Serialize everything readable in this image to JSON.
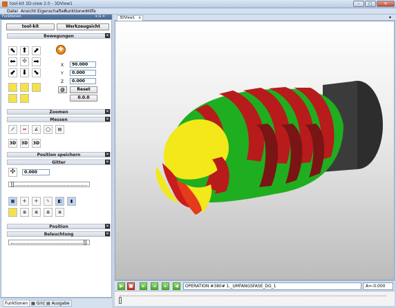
{
  "window": {
    "title": "tool-kit 3D-view 2.0 - 3DView1",
    "min": "–",
    "max": "□",
    "close": "✕"
  },
  "menu": [
    "Datei",
    "Ansicht",
    "Eigenschaften",
    "Funktionen",
    "Hilfe"
  ],
  "panel": {
    "title": "Funktionen",
    "controls": "▾ ⊡ ✕",
    "toolkit_button": "tool-kit",
    "workpiece_button": "Werkzeugsicht",
    "sections": {
      "bewegungen": "Bewegungen",
      "zoomen": "Zoomen",
      "messen": "Messen",
      "position_speichern": "Position speichern",
      "gitter": "Gitter",
      "position": "Position",
      "beleuchtung": "Beleuchtung"
    },
    "close_glyph": "✕",
    "coords": {
      "x_label": "X",
      "x_value": "90.000",
      "y_label": "Y",
      "y_value": "0.000",
      "z_label": "Z",
      "z_value": "0.000",
      "at_symbol": "@",
      "reset": "Reset",
      "zero": "0.0.0"
    },
    "measure_3d": [
      "3D",
      "3D",
      "3D"
    ],
    "grid_value": "0.000"
  },
  "bottom_tabs": [
    "Funktionen",
    "Grid",
    "Ausgabe"
  ],
  "doc_tab": {
    "label": "3DView1",
    "close": "x"
  },
  "playback": {
    "operation": "OPERATION #380# 1._UMFANGSFASE_DG_1",
    "angle": "A=-0.000"
  },
  "colors": {
    "green": "#1fae1f",
    "red": "#b81b1b",
    "yellow": "#f2e81a",
    "body": "#3e3e3e"
  }
}
